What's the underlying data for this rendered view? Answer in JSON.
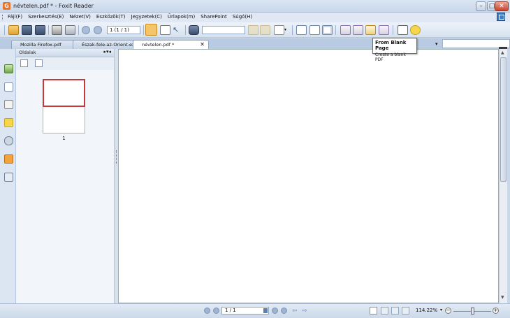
{
  "window": {
    "title": "névtelen.pdf * - Foxit Reader",
    "minimize_glyph": "–",
    "maximize_glyph": "□",
    "close_glyph": "✕"
  },
  "menu": [
    "Fájl(F)",
    "Szerkesztés(E)",
    "Nézet(V)",
    "Eszközök(T)",
    "Jegyzetek(C)",
    "Űrlapok(m)",
    "SharePoint",
    "Súgó(H)"
  ],
  "toolbar": {
    "page_field": "1 (1 / 1)",
    "search_value": ""
  },
  "tooltip": {
    "title": "From Blank Page",
    "description": "Create a blank PDF"
  },
  "tabs": [
    {
      "label": "Mozilla Firefox.pdf"
    },
    {
      "label": "Észak-fele-az-Orient-expr..."
    },
    {
      "label": "névtelen.pdf *"
    }
  ],
  "side_panel": {
    "title": "Oldalak",
    "thumbnail_label": "1"
  },
  "status": {
    "page": "1 / 1",
    "zoom": "114.22%"
  },
  "colors": {
    "accent": "#3d7fc7",
    "selection": "#c43a3a",
    "close_button": "#c8442e"
  }
}
